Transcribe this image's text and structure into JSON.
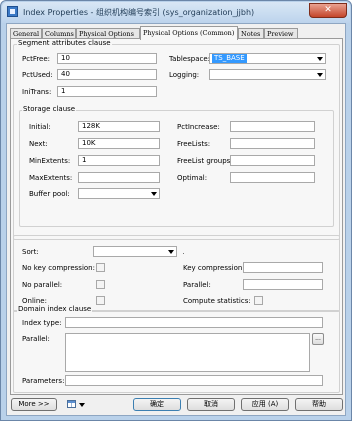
{
  "window": {
    "title": "Index Properties - 组织机构编号索引 (sys_organization_jjbh)",
    "close_glyph": "✕"
  },
  "tabs": [
    {
      "label": "General"
    },
    {
      "label": "Columns"
    },
    {
      "label": "Physical Options"
    },
    {
      "label": "Physical Options (Common)"
    },
    {
      "label": "Notes"
    },
    {
      "label": "Preview"
    }
  ],
  "segment": {
    "legend": "Segment attributes clause",
    "pctfree_label": "PctFree:",
    "pctfree_value": "10",
    "pctused_label": "PctUsed:",
    "pctused_value": "40",
    "initrans_label": "IniTrans:",
    "initrans_value": "1",
    "tablespace_label": "Tablespace:",
    "tablespace_value": "TS_BASE",
    "logging_label": "Logging:",
    "logging_value": ""
  },
  "storage": {
    "legend": "Storage clause",
    "initial_label": "Initial:",
    "initial_value": "128K",
    "next_label": "Next:",
    "next_value": "10K",
    "minextents_label": "MinExtents:",
    "minextents_value": "1",
    "maxextents_label": "MaxExtents:",
    "maxextents_value": "",
    "bufferpool_label": "Buffer pool:",
    "bufferpool_value": "",
    "pctincrease_label": "PctIncrease:",
    "pctincrease_value": "",
    "freelists_label": "FreeLists:",
    "freelists_value": "",
    "freelistgroups_label": "FreeList groups:",
    "freelistgroups_value": "",
    "optimal_label": "Optimal:",
    "optimal_value": ""
  },
  "sort_section": {
    "sort_label": "Sort:",
    "sort_value": "",
    "no_key_compression_label": "No key compression:",
    "no_parallel_label": "No parallel:",
    "online_label": "Online:",
    "key_compression_label": "Key compression:",
    "key_compression_value": "",
    "parallel_label": "Parallel:",
    "parallel_value": "",
    "compute_statistics_label": "Compute statistics:"
  },
  "domain": {
    "legend": "Domain index clause",
    "index_type_label": "Index type:",
    "index_type_value": "",
    "parallel_label": "Parallel:",
    "ellipsis_glyph": "...",
    "parameters_label": "Parameters:",
    "parameters_value": ""
  },
  "footer": {
    "more_label": "More >>",
    "ok_label": "确定",
    "cancel_label": "取消",
    "apply_label": "应用 (A)",
    "help_label": "帮助"
  }
}
